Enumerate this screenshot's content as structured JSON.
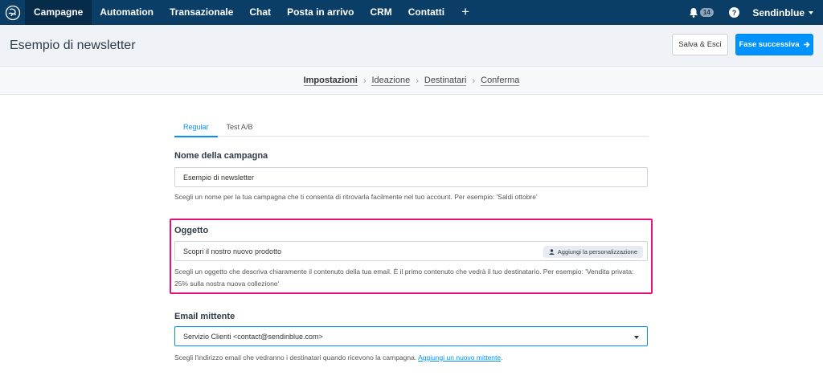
{
  "nav": {
    "items": [
      {
        "label": "Campagne",
        "active": true
      },
      {
        "label": "Automation"
      },
      {
        "label": "Transazionale"
      },
      {
        "label": "Chat"
      },
      {
        "label": "Posta in arrivo"
      },
      {
        "label": "CRM"
      },
      {
        "label": "Contatti"
      }
    ],
    "plus": "+",
    "notification_count": "14",
    "help": "?",
    "account": "Sendinblue"
  },
  "header": {
    "title": "Esempio di newsletter",
    "save_label": "Salva & Esci",
    "next_label": "Fase successiva"
  },
  "stepper": {
    "steps": [
      "Impostazioni",
      "Ideazione",
      "Destinatari",
      "Conferma"
    ],
    "separator": "›"
  },
  "tabs": [
    "Regular",
    "Test A/B"
  ],
  "campaign_name": {
    "label": "Nome della campagna",
    "value": "Esempio di newsletter",
    "help": "Scegli un nome per la tua campagna che ti consenta di ritrovarla facilmente nel tuo account. Per esempio: 'Saldi ottobre'"
  },
  "subject": {
    "label": "Oggetto",
    "value": "Scopri il nostro nuovo prodotto",
    "personalize_label": "Aggiungi la personalizzazione",
    "help": "Scegli un oggetto che descriva chiaramente il contenuto della tua email. È il primo contenuto che vedrà il tuo destinatario. Per esempio: 'Vendita privata: 25% sulla nostra nuova collezione'"
  },
  "sender": {
    "label": "Email mittente",
    "value": "Servizio Clienti <contact@sendinblue.com>",
    "help": "Scegli l'indirizzo email che vedranno i destinatari quando ricevono la campagna.",
    "link": "Aggiungi un nuovo mittente",
    "help_end": "."
  },
  "colors": {
    "nav_bg": "#0b3e66",
    "primary": "#0092ff",
    "highlight": "#e8137a"
  }
}
